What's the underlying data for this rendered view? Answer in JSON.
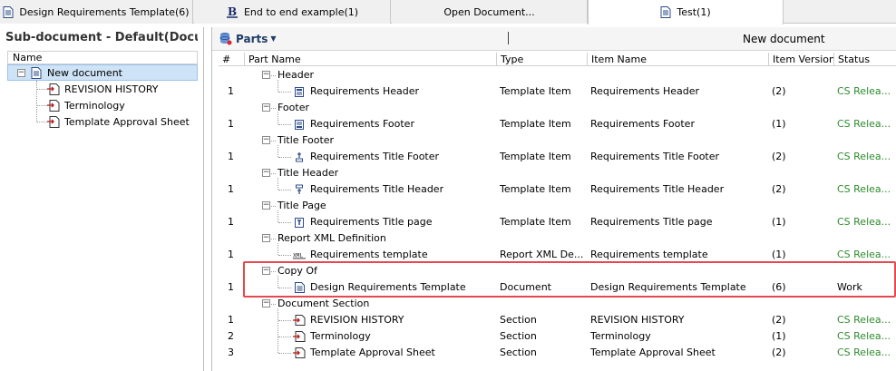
{
  "tabs": [
    {
      "label": "Design Requirements Template(6)",
      "icon": "document-icon"
    },
    {
      "label": "End to end example(1)",
      "icon": "bold-b-icon"
    },
    {
      "label": "Open Document...",
      "icon": ""
    },
    {
      "label": "Test(1)",
      "icon": "document-icon"
    }
  ],
  "left_pane": {
    "title": "Sub-document - Default(Document)",
    "column_header": "Name",
    "root": "New document",
    "children": [
      "REVISION HISTORY",
      "Terminology",
      "Template Approval Sheet"
    ]
  },
  "toolbar": {
    "parts_label": "Parts",
    "separator": "|",
    "document_title": "New document"
  },
  "grid": {
    "columns": [
      "#",
      "Part Name",
      "Type",
      "Item Name",
      "Item Version",
      "Status"
    ],
    "groups": [
      {
        "name": "Header",
        "items": [
          {
            "num": "1",
            "part": "Requirements Header",
            "type": "Template Item",
            "item": "Requirements Header",
            "version": "(2)",
            "status": "CS Relea...",
            "icon": "header-template-icon"
          }
        ]
      },
      {
        "name": "Footer",
        "items": [
          {
            "num": "1",
            "part": "Requirements Footer",
            "type": "Template Item",
            "item": "Requirements Footer",
            "version": "(1)",
            "status": "CS Relea...",
            "icon": "footer-template-icon"
          }
        ]
      },
      {
        "name": "Title Footer",
        "items": [
          {
            "num": "1",
            "part": "Requirements Title Footer",
            "type": "Template Item",
            "item": "Requirements Title Footer",
            "version": "(2)",
            "status": "CS Relea...",
            "icon": "title-footer-icon"
          }
        ]
      },
      {
        "name": "Title Header",
        "items": [
          {
            "num": "1",
            "part": "Requirements Title Header",
            "type": "Template Item",
            "item": "Requirements Title Header",
            "version": "(2)",
            "status": "CS Relea...",
            "icon": "title-header-icon"
          }
        ]
      },
      {
        "name": "Title Page",
        "items": [
          {
            "num": "1",
            "part": "Requirements Title page",
            "type": "Template Item",
            "item": "Requirements Title page",
            "version": "(1)",
            "status": "CS Relea...",
            "icon": "title-page-icon"
          }
        ]
      },
      {
        "name": "Report XML Definition",
        "items": [
          {
            "num": "1",
            "part": "Requirements template",
            "type": "Report XML De...",
            "item": "Requirements template",
            "version": "(1)",
            "status": "CS Relea...",
            "icon": "xml-icon"
          }
        ]
      },
      {
        "name": "Copy Of",
        "items": [
          {
            "num": "1",
            "part": "Design Requirements Template",
            "type": "Document",
            "item": "Design Requirements Template",
            "version": "(6)",
            "status": "Work",
            "icon": "document-icon"
          }
        ]
      },
      {
        "name": "Document Section",
        "items": [
          {
            "num": "1",
            "part": "REVISION HISTORY",
            "type": "Section",
            "item": "REVISION HISTORY",
            "version": "(2)",
            "status": "CS Relea...",
            "icon": "section-icon"
          },
          {
            "num": "2",
            "part": "Terminology",
            "type": "Section",
            "item": "Terminology",
            "version": "(1)",
            "status": "CS Relea...",
            "icon": "section-icon"
          },
          {
            "num": "3",
            "part": "Template Approval Sheet",
            "type": "Section",
            "item": "Template Approval Sheet",
            "version": "(2)",
            "status": "CS Relea...",
            "icon": "section-icon"
          }
        ]
      }
    ]
  },
  "colors": {
    "status_released": "#2e8b2e",
    "highlight": "#e5484d",
    "selection": "#cfe3f7"
  }
}
